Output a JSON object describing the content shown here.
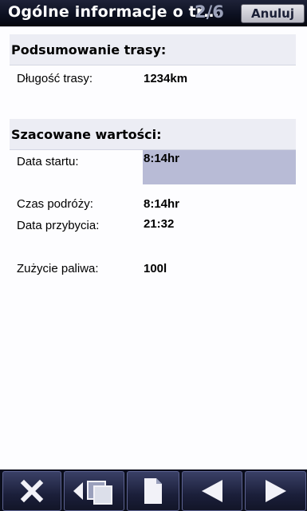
{
  "header": {
    "title": "Ogólne informacje o tr…",
    "pager": "2/6",
    "cancel_label": "Anuluj"
  },
  "route_summary": {
    "heading": "Podsumowanie trasy:",
    "length_label": "Długość trasy:",
    "length_value": "1234km"
  },
  "estimates": {
    "heading": "Szacowane wartości:",
    "start_label": "Data startu:",
    "start_value": "8:14hr",
    "travel_label": "Czas podróży:",
    "travel_value": "8:14hr",
    "arrival_label": "Data przybycia:",
    "arrival_value": "21:32",
    "fuel_label": "Zużycie paliwa:",
    "fuel_value": "100l"
  },
  "toolbar": {
    "icons": [
      "close-icon",
      "back-to-list-icon",
      "page-icon",
      "previous-icon",
      "next-icon"
    ]
  },
  "colors": {
    "titlebar": "#0d1122",
    "section_header_bg": "#ecedf4",
    "highlight": "#b8bbd6",
    "toolbar_button": "#1b1f3a"
  }
}
